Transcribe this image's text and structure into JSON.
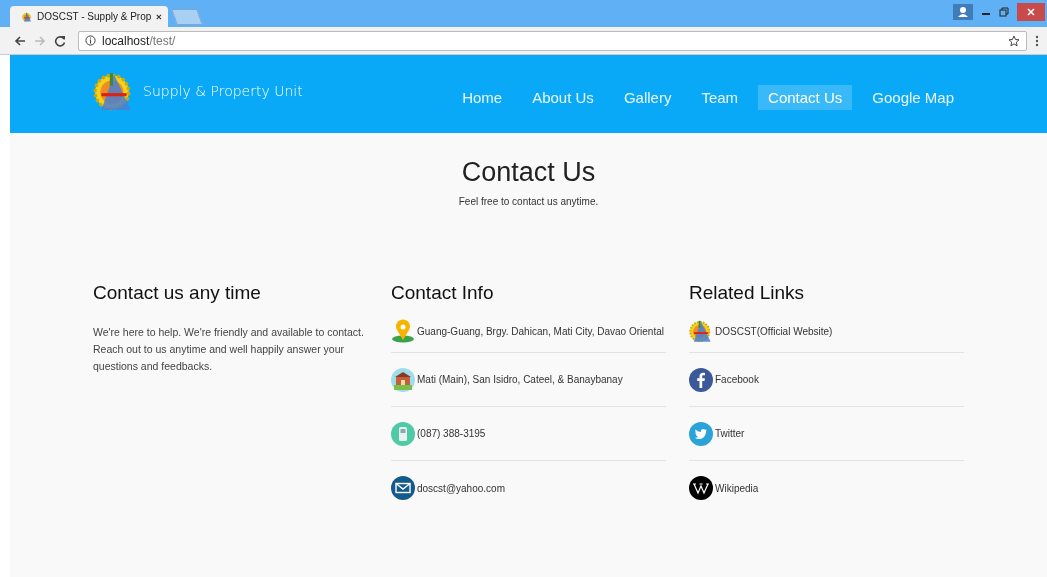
{
  "browser": {
    "tab_title": "DOSCST - Supply & Prop",
    "address": {
      "host": "localhost",
      "path": "/test/"
    }
  },
  "header": {
    "site_title": "Supply & Property Unit",
    "nav": [
      {
        "label": "Home",
        "selected": false
      },
      {
        "label": "About Us",
        "selected": false
      },
      {
        "label": "Gallery",
        "selected": false
      },
      {
        "label": "Team",
        "selected": false
      },
      {
        "label": "Contact Us",
        "selected": true
      },
      {
        "label": "Google Map",
        "selected": false
      }
    ]
  },
  "page": {
    "title": "Contact Us",
    "subtitle": "Feel free to contact us anytime."
  },
  "about": {
    "heading": "Contact us any time",
    "text": "We're here to help. We're friendly and available to contact. Reach out to us anytime and well happily answer your questions and feedbacks."
  },
  "contact_info": {
    "heading": "Contact Info",
    "items": [
      {
        "kind": "location",
        "text": "Guang-Guang, Brgy. Dahican, Mati City, Davao Oriental"
      },
      {
        "kind": "campus",
        "text": "Mati (Main), San Isidro, Cateel, & Banaybanay"
      },
      {
        "kind": "phone",
        "text": "(087) 388-3195"
      },
      {
        "kind": "email",
        "text": "doscst@yahoo.com"
      }
    ]
  },
  "related_links": {
    "heading": "Related Links",
    "items": [
      {
        "kind": "website",
        "text": "DOSCST(Official Website)"
      },
      {
        "kind": "facebook",
        "text": "Facebook"
      },
      {
        "kind": "twitter",
        "text": "Twitter"
      },
      {
        "kind": "wikipedia",
        "text": "Wikipedia"
      }
    ]
  }
}
